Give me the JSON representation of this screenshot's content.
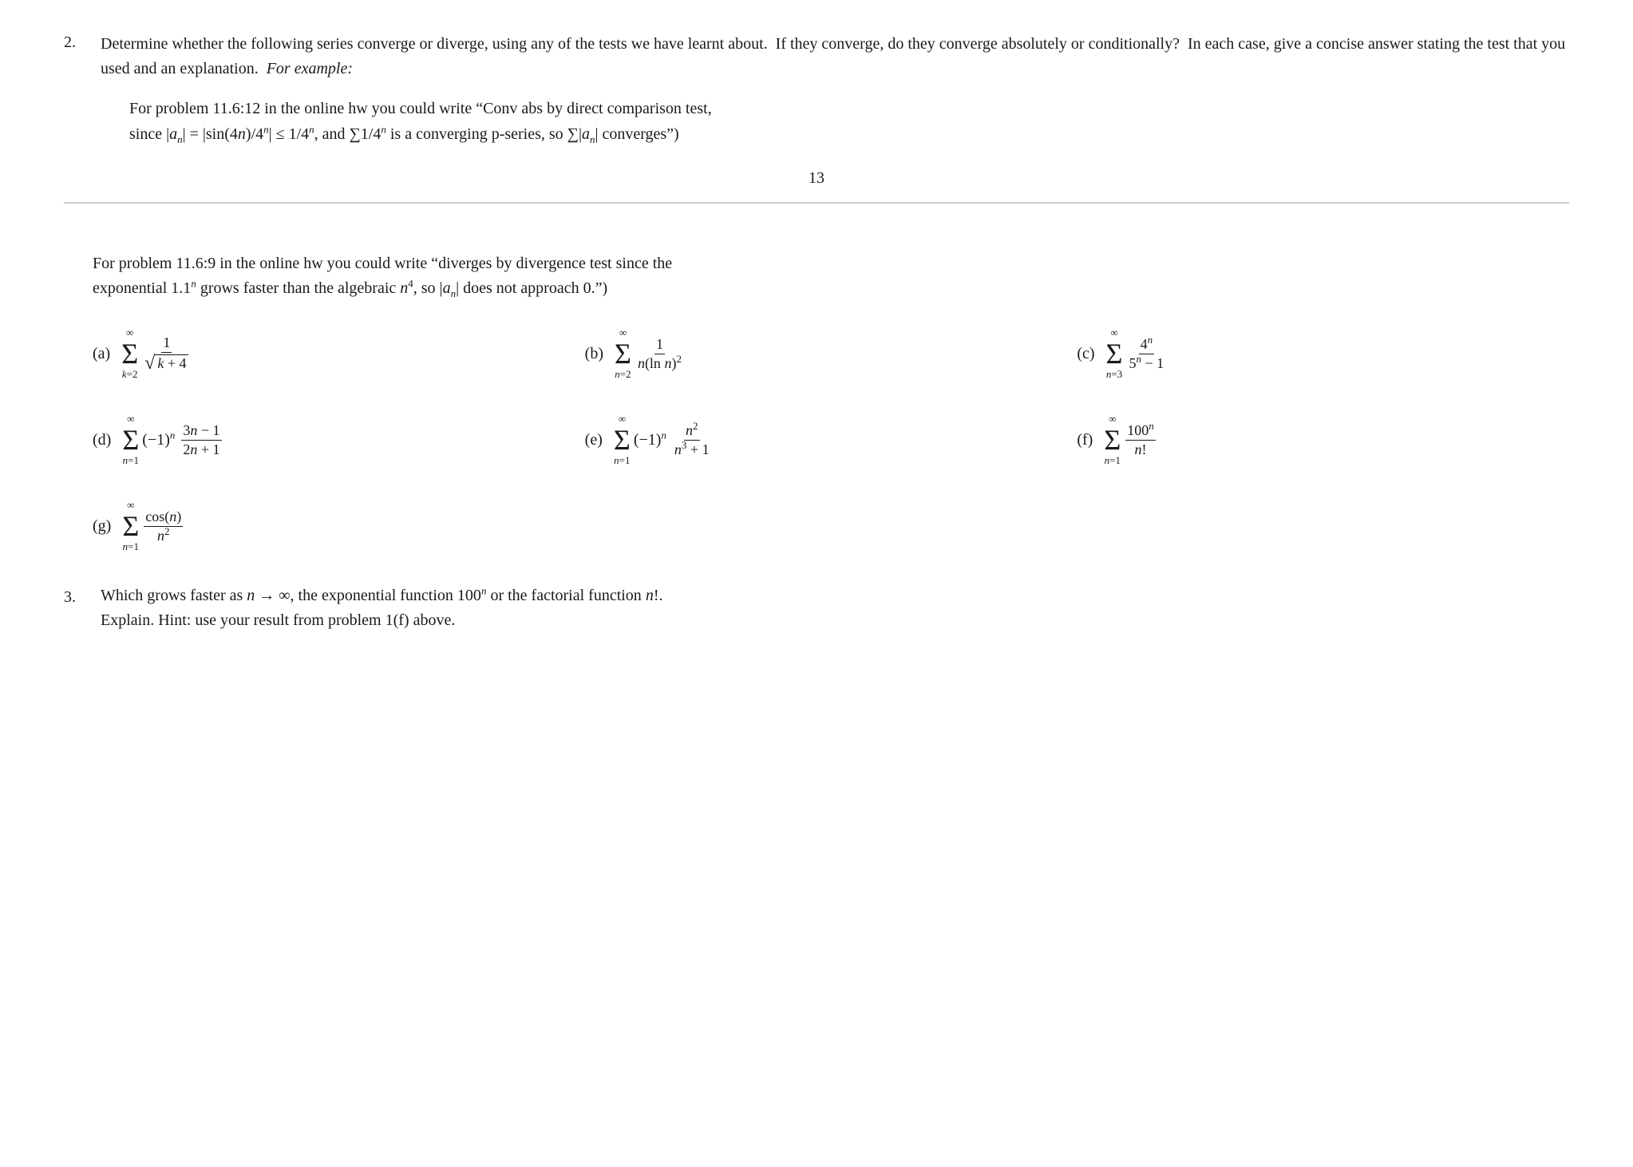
{
  "problem2": {
    "number": "2.",
    "intro_line1": "Determine whether the following series converge or diverge, using any of the tests we have",
    "intro_line2": "learnt about.  If they converge, do they converge absolutely or conditionally?  In each case,",
    "intro_line3": "give a concise answer stating the test that you used and an explanation.",
    "for_example_label": "For example:",
    "example_line1": "For problem 11.6:12 in the online hw you could write “Conv abs by direct comparison test,",
    "example_line2": "since |aₙ| = |sin(4n)/4ⁿ| ≤ 1/4ⁿ, and Σ1/4ⁿ is a converging p-series, so Σ|aₙ| converges”)",
    "page_number": "13",
    "divergence_line1": "For problem 11.6:9 in the online hw you could write “diverges by divergence test since the",
    "divergence_line2": "exponential 1.1ⁿ grows faster than the algebraic n⁴, so |aₙ| does not approach 0.”)",
    "series": {
      "a_label": "(a)",
      "b_label": "(b)",
      "c_label": "(c)",
      "d_label": "(d)",
      "e_label": "(e)",
      "f_label": "(f)",
      "g_label": "(g)"
    }
  },
  "problem3": {
    "number": "3.",
    "line1": "Which grows faster as n → ∞, the exponential function 100ⁿ or the factorial function n!.",
    "line2": "Explain.  Hint: use your result from problem 1(f) above."
  }
}
